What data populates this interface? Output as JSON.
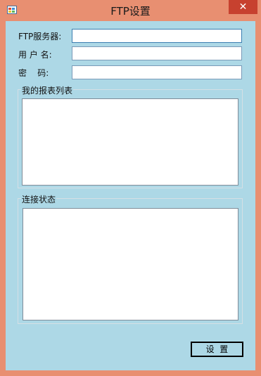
{
  "window": {
    "title": "FTP设置",
    "close_glyph": "✕",
    "icon": "app-window-icon"
  },
  "form": {
    "server_label": "FTP服务器:",
    "server_value": "",
    "username_label": "用 户 名:",
    "username_value": "",
    "password_label": "密    码:",
    "password_value": ""
  },
  "groups": {
    "reports_title": "我的报表列表",
    "status_title": "连接状态"
  },
  "buttons": {
    "set_label": "设  置"
  },
  "colors": {
    "window_frame": "#e88f71",
    "client_background": "#add8e6",
    "close_button": "#c7412f"
  }
}
